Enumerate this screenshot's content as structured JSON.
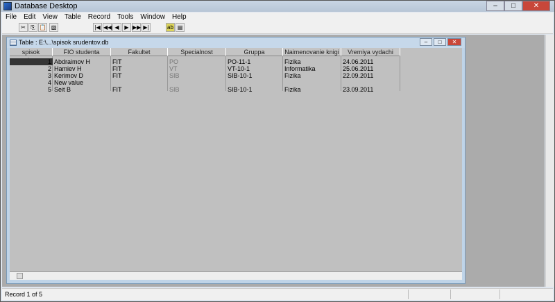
{
  "app": {
    "title": "Database Desktop"
  },
  "menu": [
    "File",
    "Edit",
    "View",
    "Table",
    "Record",
    "Tools",
    "Window",
    "Help"
  ],
  "toolbar": {
    "cut": "✂",
    "copy": "⎘",
    "paste": "📋",
    "restructure": "▧",
    "first": "|◀",
    "prev_set": "◀◀",
    "prev": "◀",
    "next": "▶",
    "next_set": "▶▶",
    "last": "▶|",
    "edit": "ab",
    "view": "▤"
  },
  "window_buttons": {
    "min": "–",
    "max": "□",
    "close": "✕"
  },
  "child": {
    "title": "Table : E:\\...\\spisok srudentov.db"
  },
  "table": {
    "headers": [
      "spisok srudentov",
      "FIO studenta",
      "Fakultet",
      "Specialnost",
      "Gruppa",
      "Naimenovanie knigi",
      "Vremiya vydachi"
    ],
    "rows": [
      [
        "1",
        "Abdraimov H",
        "FIT",
        "PO",
        "PO-11-1",
        "Fizika",
        "24.06.2011"
      ],
      [
        "2",
        "Hamiev H",
        "FIT",
        "VT",
        "VT-10-1",
        "Informatika",
        "25.06.2011"
      ],
      [
        "3",
        "Kerimov D",
        "FIT",
        "SIB",
        "SIB-10-1",
        "Fizika",
        "22.09.2011"
      ],
      [
        "4",
        "New value",
        "",
        "",
        "",
        "",
        ""
      ],
      [
        "5",
        "Seit B",
        "FIT",
        "SIB",
        "SIB-10-1",
        "Fizika",
        "23.09.2011"
      ]
    ]
  },
  "status": {
    "text": "Record 1 of 5"
  }
}
